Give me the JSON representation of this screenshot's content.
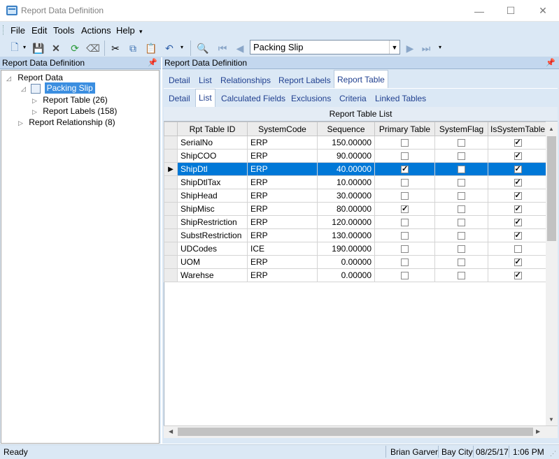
{
  "window": {
    "title": "Report Data Definition",
    "controls": [
      "minimize-icon",
      "maximize-icon",
      "close-icon"
    ]
  },
  "menu": {
    "items": [
      "File",
      "Edit",
      "Tools",
      "Actions",
      "Help"
    ]
  },
  "toolbar": {
    "record_combo_value": "Packing Slip",
    "icons": [
      "new-icon",
      "save-icon",
      "delete-icon",
      "refresh-icon",
      "clear-icon",
      "cut-icon",
      "copy-icon",
      "paste-icon",
      "undo-icon",
      "search-icon",
      "first-record-icon",
      "previous-record-icon",
      "next-record-icon",
      "last-record-icon"
    ]
  },
  "left_panel": {
    "header": "Report Data Definition",
    "tree": {
      "root": "Report Data",
      "selected": "Packing Slip",
      "children": [
        "Report Table (26)",
        "Report Labels (158)"
      ],
      "sibling": "Report Relationship (8)"
    }
  },
  "right_panel": {
    "header": "Report Data Definition",
    "tabs_top": [
      "Detail",
      "List",
      "Relationships",
      "Report Labels",
      "Report Table"
    ],
    "active_top_tab": "Report Table",
    "tabs_sub": [
      "Detail",
      "List",
      "Calculated Fields",
      "Exclusions",
      "Criteria",
      "Linked Tables"
    ],
    "active_sub_tab": "List",
    "grid_caption": "Report Table List",
    "columns": [
      "Rpt Table ID",
      "SystemCode",
      "Sequence",
      "Primary Table",
      "SystemFlag",
      "IsSystemTable"
    ],
    "rows": [
      {
        "id": "SerialNo",
        "system_code": "ERP",
        "sequence": "150.00000",
        "primary": false,
        "system_flag": false,
        "is_system": true
      },
      {
        "id": "ShipCOO",
        "system_code": "ERP",
        "sequence": "90.00000",
        "primary": false,
        "system_flag": false,
        "is_system": true
      },
      {
        "id": "ShipDtl",
        "system_code": "ERP",
        "sequence": "40.00000",
        "primary": true,
        "system_flag": false,
        "is_system": true,
        "selected": true
      },
      {
        "id": "ShipDtlTax",
        "system_code": "ERP",
        "sequence": "10.00000",
        "primary": false,
        "system_flag": false,
        "is_system": true
      },
      {
        "id": "ShipHead",
        "system_code": "ERP",
        "sequence": "30.00000",
        "primary": false,
        "system_flag": false,
        "is_system": true
      },
      {
        "id": "ShipMisc",
        "system_code": "ERP",
        "sequence": "80.00000",
        "primary": true,
        "system_flag": false,
        "is_system": true
      },
      {
        "id": "ShipRestriction",
        "system_code": "ERP",
        "sequence": "120.00000",
        "primary": false,
        "system_flag": false,
        "is_system": true
      },
      {
        "id": "SubstRestriction",
        "system_code": "ERP",
        "sequence": "130.00000",
        "primary": false,
        "system_flag": false,
        "is_system": true
      },
      {
        "id": "UDCodes",
        "system_code": "ICE",
        "sequence": "190.00000",
        "primary": false,
        "system_flag": false,
        "is_system": false
      },
      {
        "id": "UOM",
        "system_code": "ERP",
        "sequence": "0.00000",
        "primary": false,
        "system_flag": false,
        "is_system": true
      },
      {
        "id": "Warehse",
        "system_code": "ERP",
        "sequence": "0.00000",
        "primary": false,
        "system_flag": false,
        "is_system": true
      }
    ]
  },
  "status_bar": {
    "state": "Ready",
    "user": "Brian Garver",
    "site": "Bay City",
    "date": "08/25/17",
    "time": "1:06 PM"
  },
  "colors": {
    "selection": "#0078d7",
    "chrome": "#dbe8f5",
    "panel_header": "#c3d7ee"
  }
}
